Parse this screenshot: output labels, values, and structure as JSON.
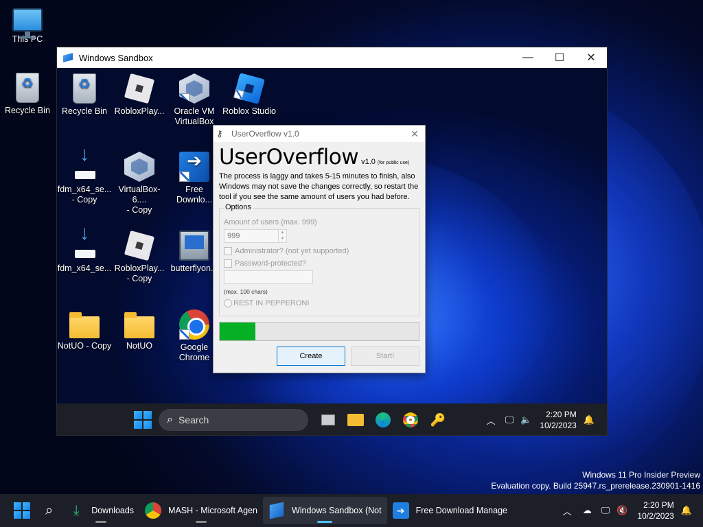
{
  "desktop": {
    "icons": [
      {
        "label": "This PC"
      },
      {
        "label": "Recycle Bin"
      }
    ],
    "watermark": {
      "line1": "Windows 11 Pro Insider Preview",
      "line2": "Evaluation copy. Build 25947.rs_prerelease.230901-1416"
    }
  },
  "sandbox_window": {
    "title": "Windows Sandbox",
    "controls": {
      "minimize": "—",
      "maximize": "☐",
      "close": "✕"
    },
    "desktop_icons": [
      {
        "label1": "Recycle Bin",
        "label2": ""
      },
      {
        "label1": "RobloxPlay...",
        "label2": ""
      },
      {
        "label1": "Oracle VM",
        "label2": "VirtualBox"
      },
      {
        "label1": "Roblox Studio",
        "label2": ""
      },
      {
        "label1": "fdm_x64_se...",
        "label2": "- Copy"
      },
      {
        "label1": "VirtualBox-6....",
        "label2": "- Copy"
      },
      {
        "label1": "Free",
        "label2": "Downlo..."
      },
      {
        "label1": "fdm_x64_se...",
        "label2": ""
      },
      {
        "label1": "RobloxPlay...",
        "label2": "- Copy"
      },
      {
        "label1": "butterflyon...",
        "label2": ""
      },
      {
        "label1": "NotUO - Copy",
        "label2": ""
      },
      {
        "label1": "NotUO",
        "label2": ""
      },
      {
        "label1": "Google",
        "label2": "Chrome"
      }
    ],
    "taskbar": {
      "search_placeholder": "Search",
      "time": "2:20 PM",
      "date": "10/2/2023"
    }
  },
  "app": {
    "title": "UserOverflow v1.0",
    "brand": "UserOverflow",
    "version": "v1.0",
    "public_note": "(for public use)",
    "description": "The process is laggy and takes 5-15 minutes to finish, also Windows may not save the changes correctly, so restart the tool if you see the same amount of users you had before.",
    "options": {
      "legend": "Options",
      "amount_label": "Amount of users (max. 999)",
      "amount_value": "999",
      "admin_label": "Administrator? (not yet supported)",
      "password_label": "Password-protected?",
      "max_chars": "(max. 100 chars)",
      "radio_label": "REST IN PEPPERONI"
    },
    "progress": 0.18,
    "progress_color": "#06b025",
    "buttons": {
      "create": "Create",
      "start": "Start!"
    }
  },
  "taskbar": {
    "items": [
      {
        "label": "Downloads"
      },
      {
        "label": "MASH - Microsoft Agen"
      },
      {
        "label": "Windows Sandbox (Not"
      },
      {
        "label": "Free Download Manage"
      }
    ],
    "time": "2:20 PM",
    "date": "10/2/2023"
  }
}
